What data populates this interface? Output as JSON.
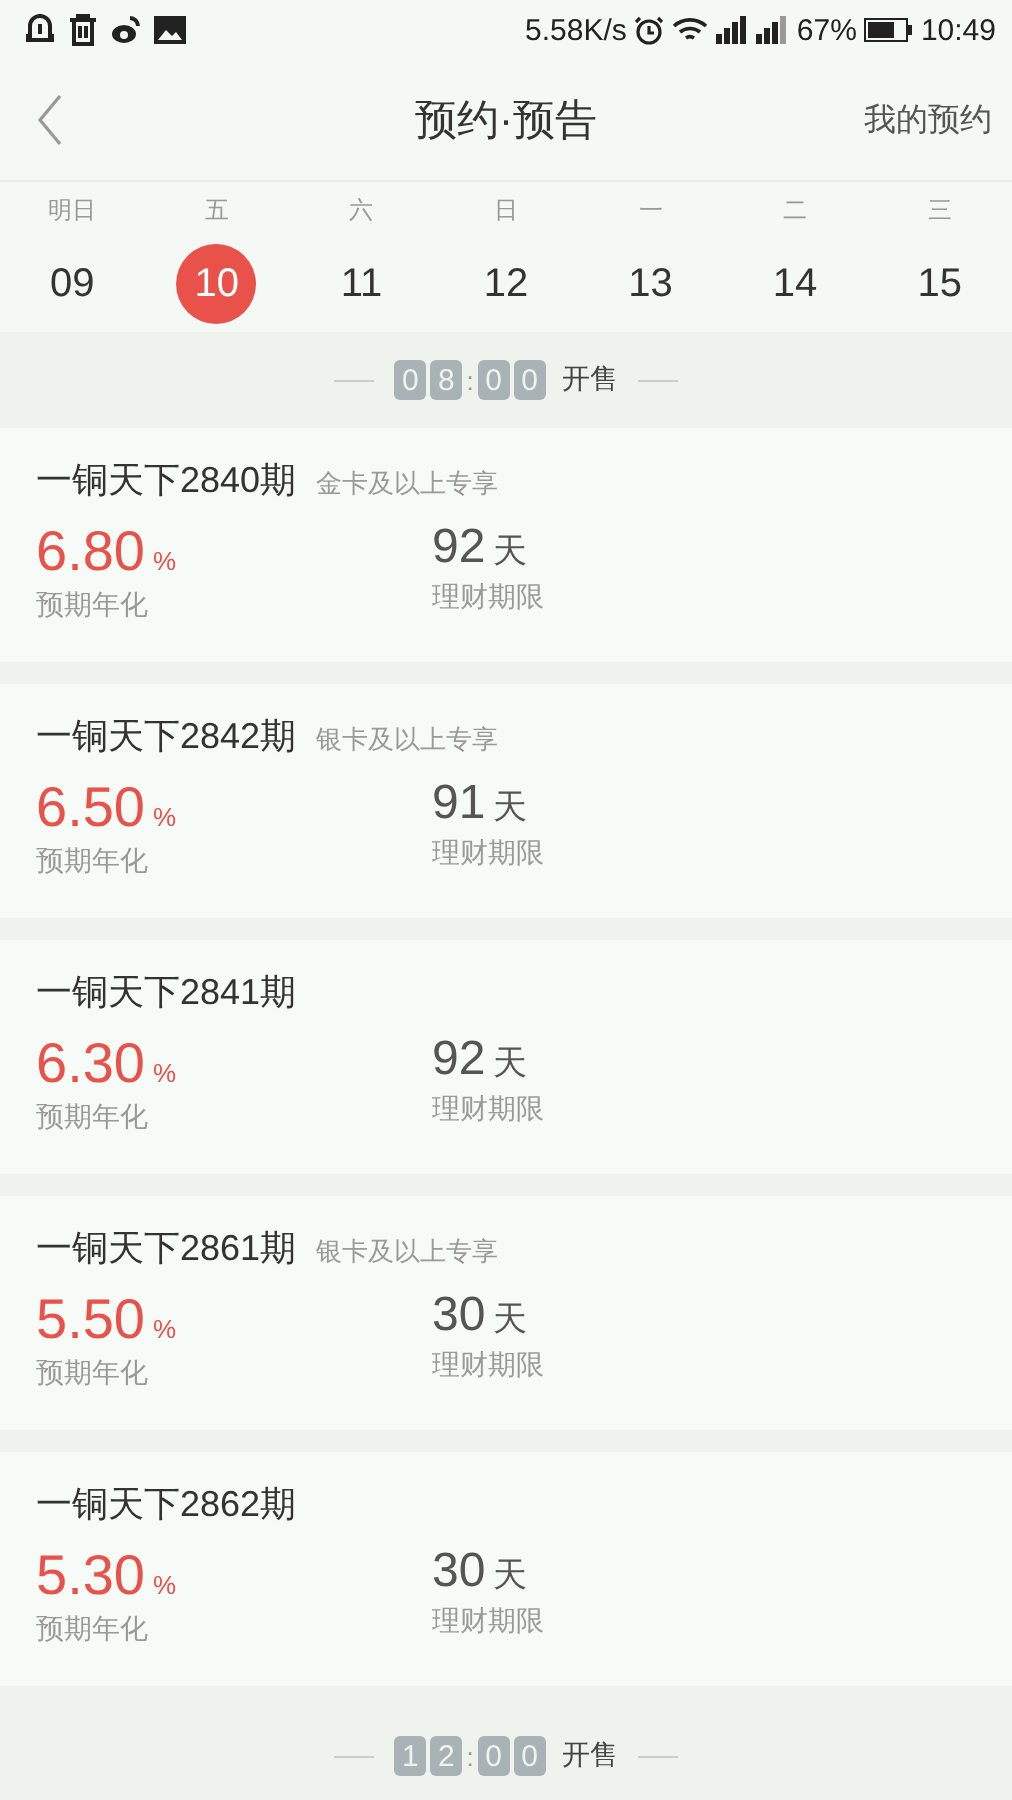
{
  "status_bar": {
    "speed": "5.58K/s",
    "battery": "67%",
    "time": "10:49"
  },
  "header": {
    "title": "预约·预告",
    "action": "我的预约"
  },
  "days": [
    {
      "weekday": "明日",
      "date": "09",
      "selected": false
    },
    {
      "weekday": "五",
      "date": "10",
      "selected": true
    },
    {
      "weekday": "六",
      "date": "11",
      "selected": false
    },
    {
      "weekday": "日",
      "date": "12",
      "selected": false
    },
    {
      "weekday": "一",
      "date": "13",
      "selected": false
    },
    {
      "weekday": "二",
      "date": "14",
      "selected": false
    },
    {
      "weekday": "三",
      "date": "15",
      "selected": false
    }
  ],
  "sessions": [
    {
      "digits": [
        "0",
        "8",
        "0",
        "0"
      ],
      "separator": ":",
      "label": "开售",
      "products": [
        {
          "name": "一铜天下2840期",
          "tag": "金卡及以上专享",
          "rate": "6.80",
          "rate_unit": "%",
          "rate_label": "预期年化",
          "term": "92",
          "term_unit": "天",
          "term_label": "理财期限"
        },
        {
          "name": "一铜天下2842期",
          "tag": "银卡及以上专享",
          "rate": "6.50",
          "rate_unit": "%",
          "rate_label": "预期年化",
          "term": "91",
          "term_unit": "天",
          "term_label": "理财期限"
        },
        {
          "name": "一铜天下2841期",
          "rate": "6.30",
          "rate_unit": "%",
          "rate_label": "预期年化",
          "term": "92",
          "term_unit": "天",
          "term_label": "理财期限"
        },
        {
          "name": "一铜天下2861期",
          "tag": "银卡及以上专享",
          "rate": "5.50",
          "rate_unit": "%",
          "rate_label": "预期年化",
          "term": "30",
          "term_unit": "天",
          "term_label": "理财期限"
        },
        {
          "name": "一铜天下2862期",
          "rate": "5.30",
          "rate_unit": "%",
          "rate_label": "预期年化",
          "term": "30",
          "term_unit": "天",
          "term_label": "理财期限"
        }
      ]
    },
    {
      "digits": [
        "1",
        "2",
        "0",
        "0"
      ],
      "separator": ":",
      "label": "开售"
    }
  ]
}
